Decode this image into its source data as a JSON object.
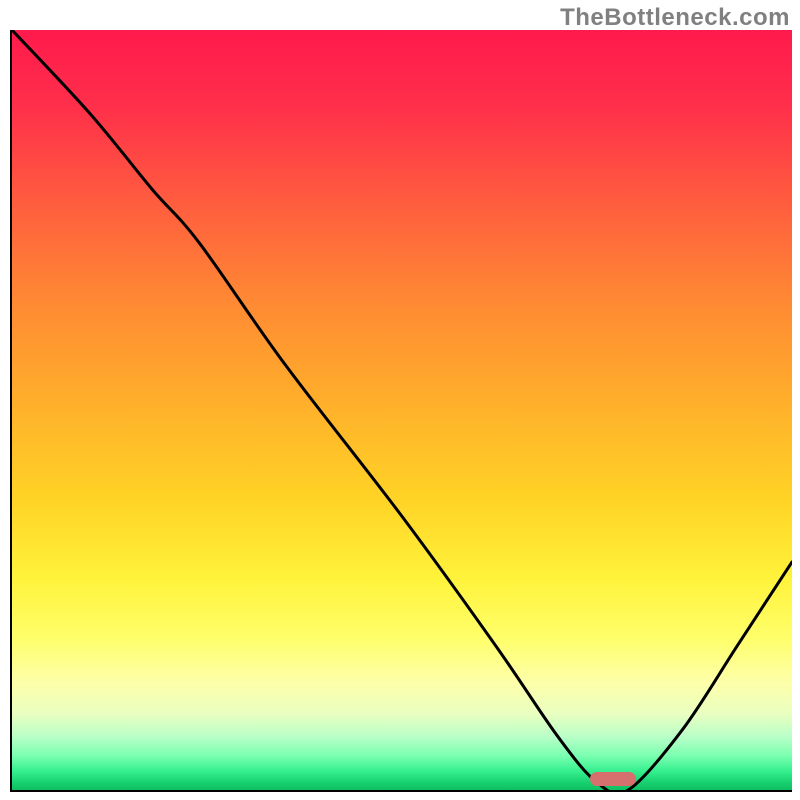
{
  "watermark": "TheBottleneck.com",
  "colors": {
    "gradient_top": "#ff1a4d",
    "gradient_mid_orange": "#ff8a33",
    "gradient_mid_yellow": "#fff23a",
    "gradient_bottom": "#0fbf62",
    "curve": "#000000",
    "marker": "#d6706f",
    "axis": "#000000",
    "watermark_text": "#808080"
  },
  "chart_data": {
    "type": "line",
    "title": "",
    "xlabel": "",
    "ylabel": "",
    "xlim": [
      0,
      100
    ],
    "ylim": [
      0,
      100
    ],
    "grid": false,
    "legend": false,
    "series": [
      {
        "name": "bottleneck-curve",
        "x": [
          0,
          10,
          18,
          24,
          35,
          50,
          62,
          70,
          75,
          79,
          86,
          93,
          100
        ],
        "values": [
          100,
          89,
          79,
          72,
          56,
          36,
          19,
          7,
          1,
          0,
          8,
          19,
          30
        ]
      }
    ],
    "annotations": [
      {
        "name": "optimal-marker",
        "x": 77,
        "y": 1.5,
        "shape": "pill",
        "color": "#d6706f"
      }
    ]
  }
}
